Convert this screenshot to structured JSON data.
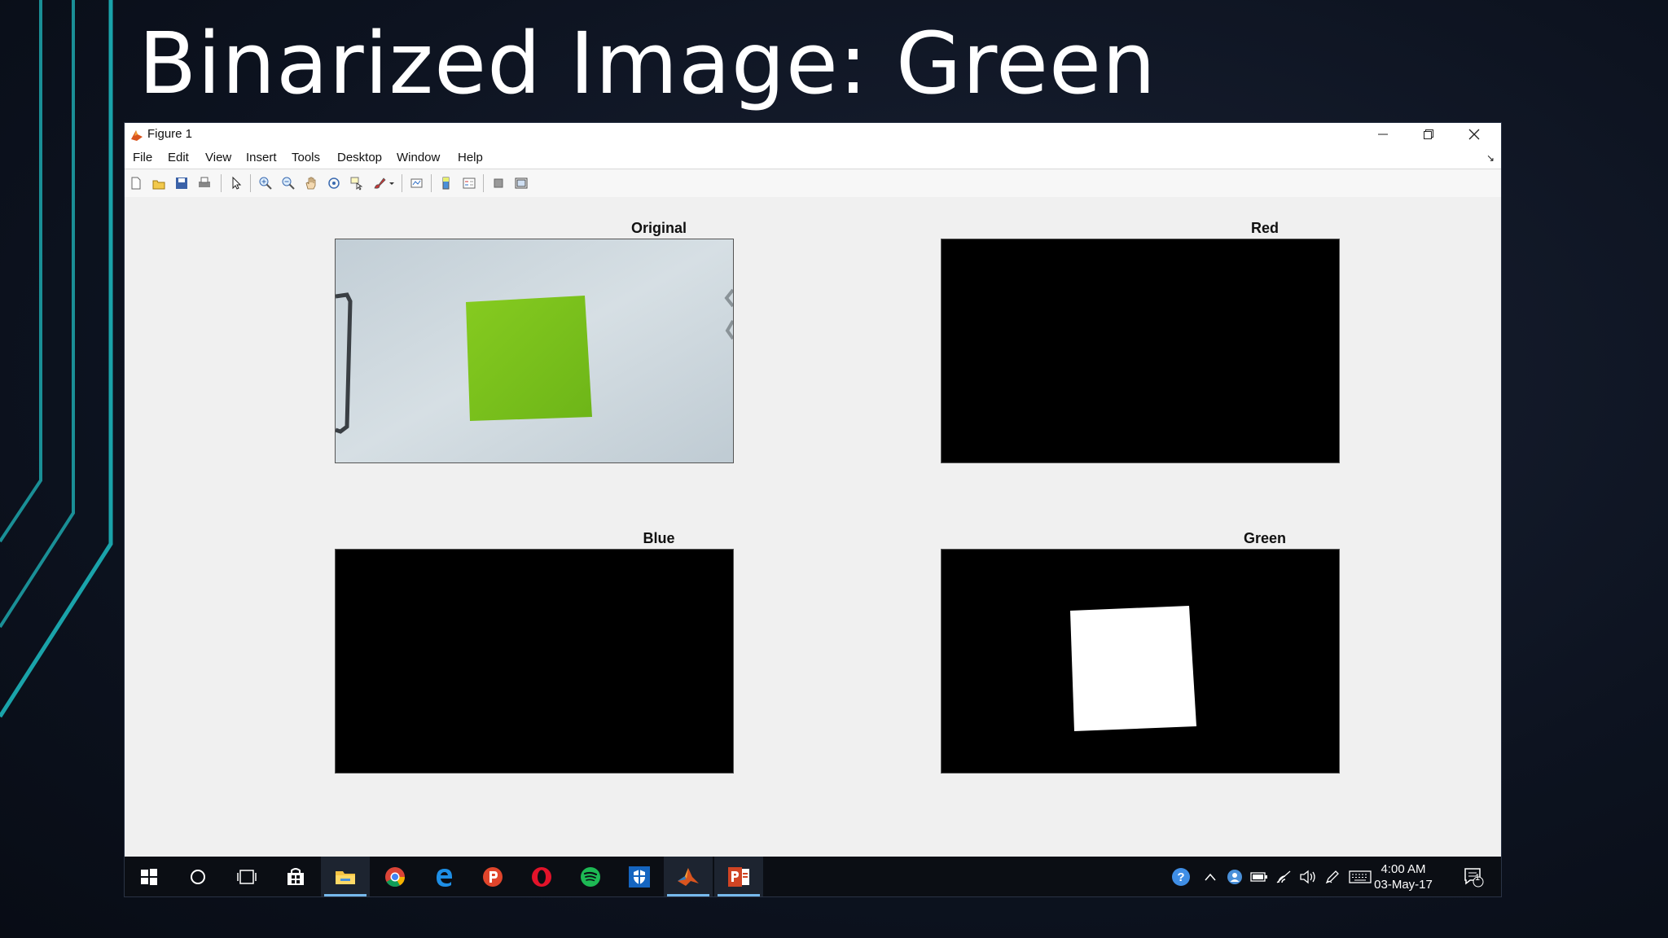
{
  "slide": {
    "title": "Binarized Image: Green",
    "accent_color": "#1a9aa0"
  },
  "window": {
    "title": "Figure 1",
    "controls": [
      "minimize-icon",
      "restore-icon",
      "close-icon"
    ]
  },
  "menubar": {
    "items": [
      "File",
      "Edit",
      "View",
      "Insert",
      "Tools",
      "Desktop",
      "Window",
      "Help"
    ]
  },
  "toolbar": {
    "icons": [
      "new-figure-icon",
      "open-file-icon",
      "save-icon",
      "print-icon",
      "edit-plot-arrow-icon",
      "zoom-in-icon",
      "zoom-out-icon",
      "pan-hand-icon",
      "rotate-3d-icon",
      "data-cursor-icon",
      "brush-icon",
      "link-plot-icon",
      "insert-colorbar-icon",
      "insert-legend-icon",
      "hide-plot-tools-icon",
      "show-plot-tools-icon"
    ]
  },
  "figure": {
    "subplots": [
      {
        "title": "Original",
        "content": "photo of green square on white paper"
      },
      {
        "title": "Red",
        "content": "all black"
      },
      {
        "title": "Blue",
        "content": "all black"
      },
      {
        "title": "Green",
        "content": "white square on black"
      }
    ],
    "colors": {
      "green_paper": "#7cc31c",
      "background_paper": "#c8d4da",
      "mask_white": "#ffffff",
      "mask_black": "#000000"
    }
  },
  "taskbar": {
    "apps": [
      "windows-start-icon",
      "cortana-search-icon",
      "task-view-icon",
      "store-icon",
      "file-explorer-icon",
      "chrome-icon",
      "edge-icon",
      "p-app-icon",
      "opera-icon",
      "spotify-icon",
      "shield-app-icon",
      "matlab-icon",
      "powerpoint-icon"
    ],
    "tray_icons": [
      "help-icon",
      "chevron-up-icon",
      "user-icon",
      "battery-icon",
      "wifi-icon",
      "volume-icon",
      "pen-icon",
      "keyboard-icon"
    ],
    "time": "4:00 AM",
    "date": "03-May-17",
    "notification_count": "1"
  }
}
